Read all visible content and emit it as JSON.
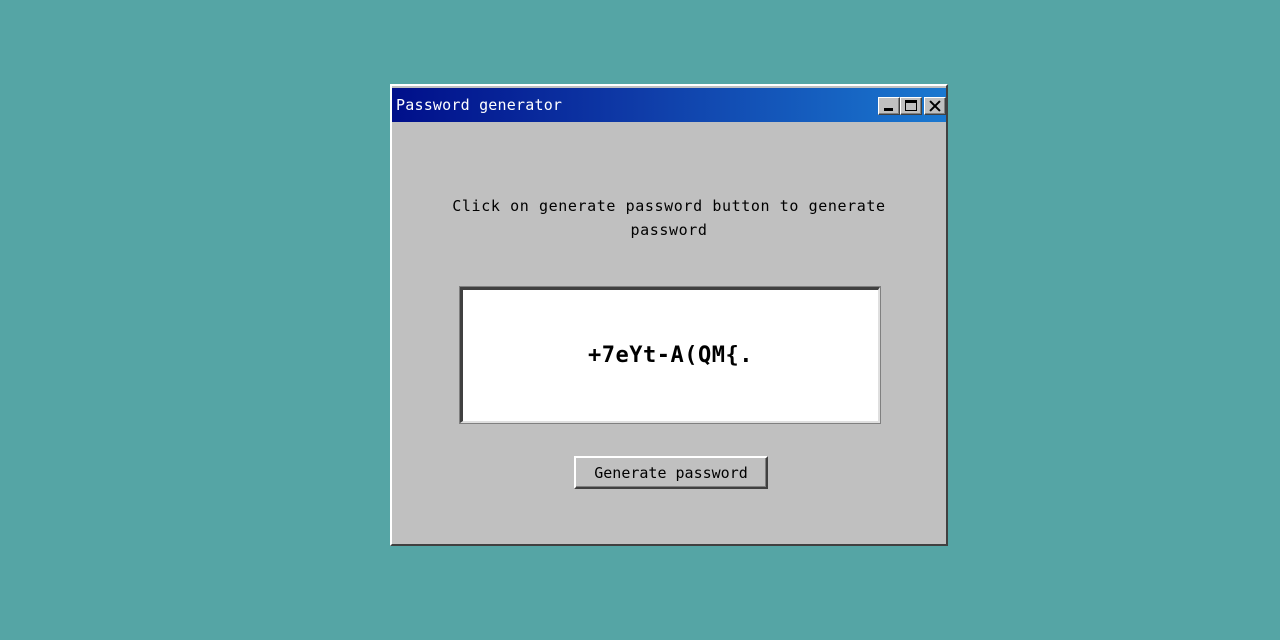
{
  "window": {
    "title": "Password generator",
    "controls": {
      "minimize": "minimize-icon",
      "maximize": "maximize-icon",
      "close": "close-icon"
    }
  },
  "main": {
    "instructions": "Click on generate password button to generate password",
    "password": "+7eYt-A(QM{.",
    "generate_label": "Generate password"
  },
  "colors": {
    "desktop": "#55a5a5",
    "window_face": "#c0c0c0",
    "title_gradient_start": "#000f8a",
    "title_gradient_end": "#1a78d0"
  }
}
